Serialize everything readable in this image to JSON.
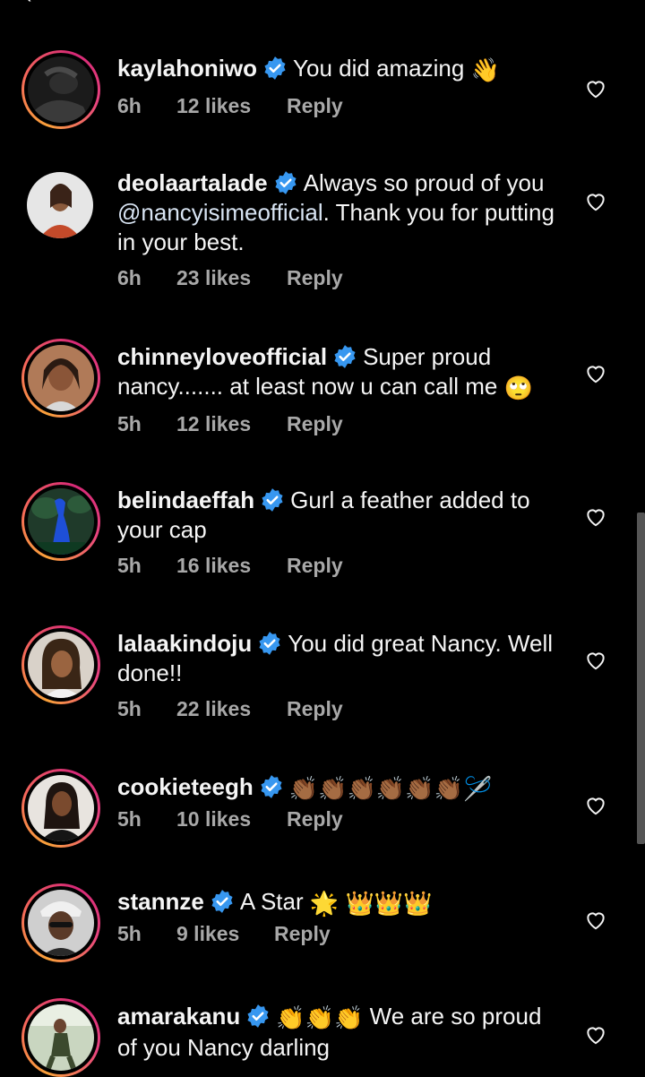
{
  "comments": [
    {
      "username": "kaylahoniwo",
      "text_parts": [
        "You did amazing"
      ],
      "emoji": "👋",
      "time": "6h",
      "likes": "12 likes",
      "reply": "Reply"
    },
    {
      "username": "deolaartalade",
      "text_before": "Always so proud of you ",
      "mention": "@nancyisimeofficial",
      "text_after": ". Thank you for putting in your best.",
      "time": "6h",
      "likes": "23 likes",
      "reply": "Reply"
    },
    {
      "username": "chinneyloveofficial",
      "text": "Super proud nancy....... at least now u can call me",
      "emoji": "🙄",
      "time": "5h",
      "likes": "12 likes",
      "reply": "Reply"
    },
    {
      "username": "belindaeffah",
      "text": "Gurl a feather added to your cap",
      "time": "5h",
      "likes": "16 likes",
      "reply": "Reply"
    },
    {
      "username": "lalaakindoju",
      "text": "You did great Nancy. Well done!!",
      "time": "5h",
      "likes": "22 likes",
      "reply": "Reply"
    },
    {
      "username": "cookieteegh",
      "emoji": "👏🏾👏🏾👏🏾👏🏾👏🏾👏🏾🪡",
      "time": "5h",
      "likes": "10 likes",
      "reply": "Reply"
    },
    {
      "username": "stannze",
      "text": "A Star",
      "emoji_star": "🌟",
      "emoji_crowns": "👑👑👑",
      "time": "5h",
      "likes": "9 likes",
      "reply": "Reply"
    },
    {
      "username": "amarakanu",
      "emoji": "👏👏👏",
      "text": "We are so proud of you Nancy darling"
    }
  ],
  "icons": {
    "verified": "verified-badge-icon",
    "heart": "heart-outline-icon"
  },
  "colors": {
    "background": "#000000",
    "text": "#f5f5f5",
    "meta": "#a8a8a8",
    "verified": "#3797f0"
  }
}
